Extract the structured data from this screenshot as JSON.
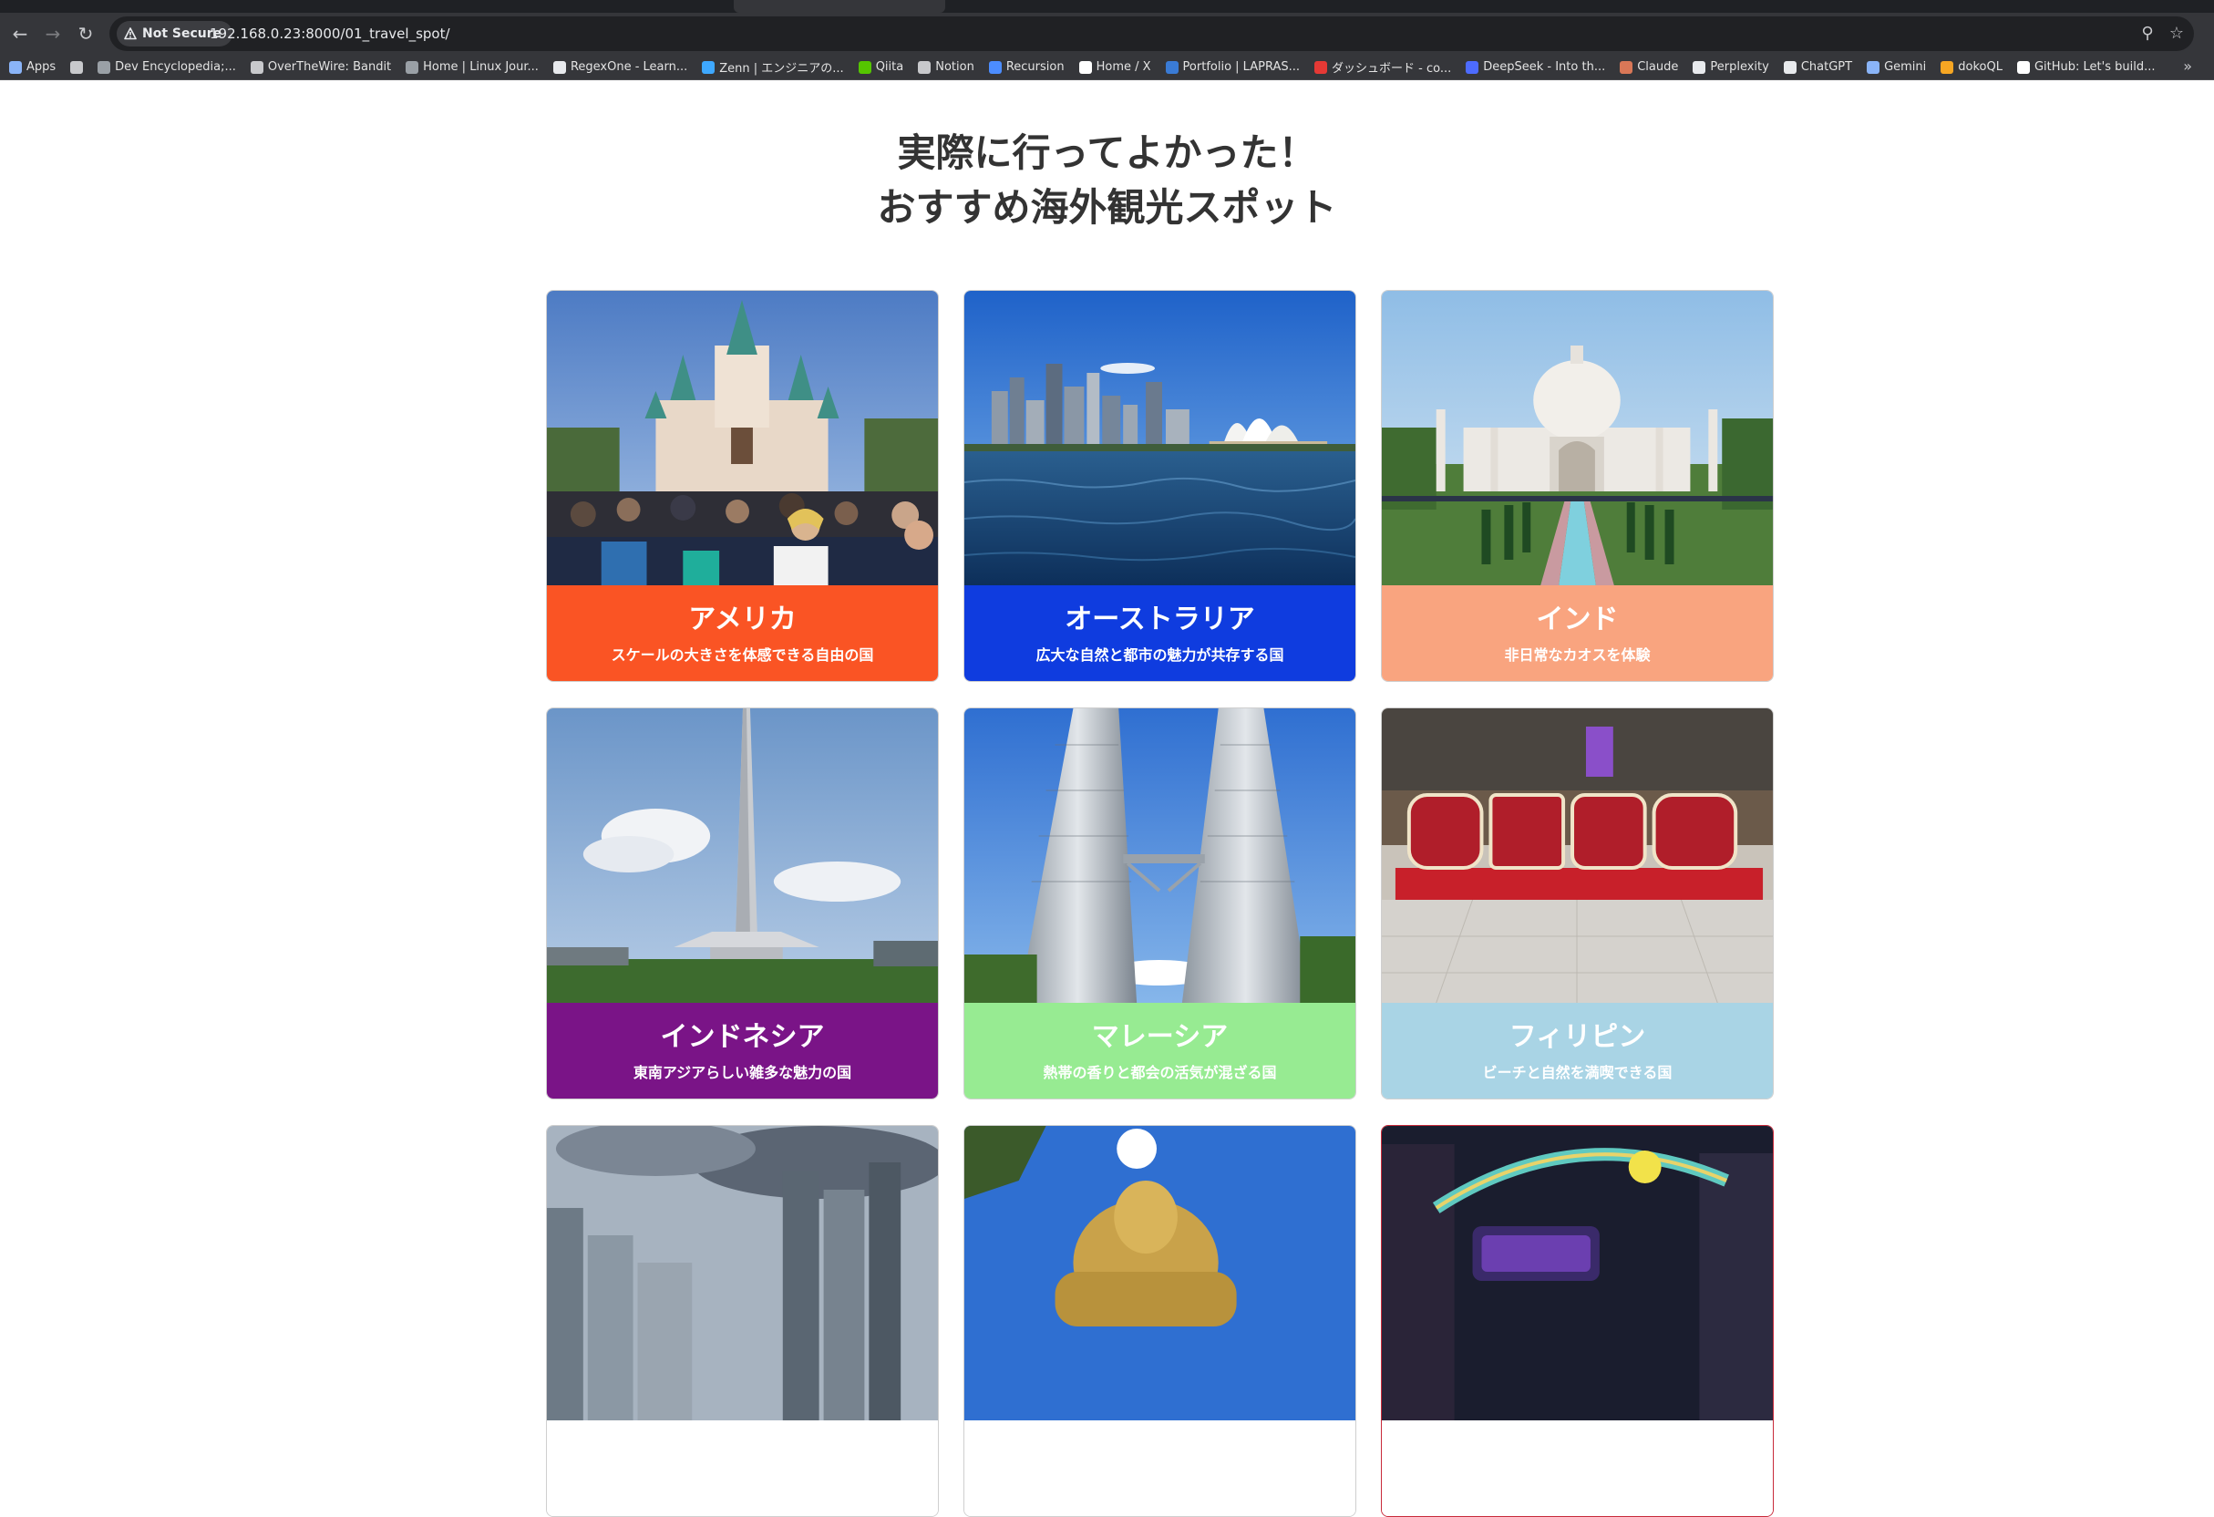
{
  "browser": {
    "security_label": "Not Secure",
    "url": "192.168.0.23:8000/01_travel_spot/"
  },
  "bookmarks": [
    {
      "label": "Apps",
      "icon": "apps-grid-icon",
      "color": "#8ab4f8"
    },
    {
      "label": "",
      "icon": "tab-groups-icon",
      "color": "#c8c9cc"
    },
    {
      "label": "Dev Encyclopedia;...",
      "icon": "globe-icon",
      "color": "#9aa0a6"
    },
    {
      "label": "OverTheWire: Bandit",
      "icon": "flag-icon",
      "color": "#c8c9cc"
    },
    {
      "label": "Home | Linux Jour...",
      "icon": "globe-icon",
      "color": "#9aa0a6"
    },
    {
      "label": "RegexOne - Learn...",
      "icon": "regex-icon",
      "color": "#e8eaed"
    },
    {
      "label": "Zenn | エンジニアの...",
      "icon": "zenn-icon",
      "color": "#3ea8ff"
    },
    {
      "label": "Qiita",
      "icon": "qiita-icon",
      "color": "#55c500"
    },
    {
      "label": "Notion",
      "icon": "home-icon",
      "color": "#c8c9cc"
    },
    {
      "label": "Recursion",
      "icon": "recursion-icon",
      "color": "#4c8dff"
    },
    {
      "label": "Home / X",
      "icon": "x-icon",
      "color": "#ffffff"
    },
    {
      "label": "Portfolio | LAPRAS...",
      "icon": "lapras-icon",
      "color": "#3a7bd5"
    },
    {
      "label": "ダッシュボード - co...",
      "icon": "dashboard-icon",
      "color": "#e53935"
    },
    {
      "label": "DeepSeek - Into th...",
      "icon": "deepseek-icon",
      "color": "#4d6bfe"
    },
    {
      "label": "Claude",
      "icon": "claude-icon",
      "color": "#d97757"
    },
    {
      "label": "Perplexity",
      "icon": "perplexity-icon",
      "color": "#e8eaed"
    },
    {
      "label": "ChatGPT",
      "icon": "chatgpt-icon",
      "color": "#e8eaed"
    },
    {
      "label": "Gemini",
      "icon": "gemini-icon",
      "color": "#8ab4f8"
    },
    {
      "label": "dokoQL",
      "icon": "dokoql-icon",
      "color": "#f6a623"
    },
    {
      "label": "GitHub: Let's build...",
      "icon": "github-icon",
      "color": "#ffffff"
    }
  ],
  "page": {
    "title_line1": "実際に行ってよかった！",
    "title_line2": "おすすめ海外観光スポット"
  },
  "cards": [
    {
      "title": "アメリカ",
      "subtitle": "スケールの大きさを体感できる自由の国",
      "color": "#fa5424",
      "photo": "castle-photo"
    },
    {
      "title": "オーストラリア",
      "subtitle": "広大な自然と都市の魅力が共存する国",
      "color": "#0f3cdf",
      "photo": "sydney-harbour-photo"
    },
    {
      "title": "インド",
      "subtitle": "非日常なカオスを体験",
      "color": "#f9a47f",
      "photo": "taj-mahal-photo"
    },
    {
      "title": "インドネシア",
      "subtitle": "東南アジアらしい雑多な魅力の国",
      "color": "#7a1487",
      "photo": "monument-tower-photo"
    },
    {
      "title": "マレーシア",
      "subtitle": "熱帯の香りと都会の活気が混ざる国",
      "color": "#97eb92",
      "photo": "twin-towers-photo"
    },
    {
      "title": "フィリピン",
      "subtitle": "ビーチと自然を満喫できる国",
      "color": "#a9d4e5",
      "photo": "cebu-sign-photo"
    },
    {
      "title": "",
      "subtitle": "",
      "color": "#ffffff",
      "photo": "singapore-skyline-photo"
    },
    {
      "title": "",
      "subtitle": "",
      "color": "#ffffff",
      "photo": "golden-buddha-photo"
    },
    {
      "title": "",
      "subtitle": "",
      "color": "#ffffff",
      "photo": "vibrant-night-photo"
    }
  ]
}
